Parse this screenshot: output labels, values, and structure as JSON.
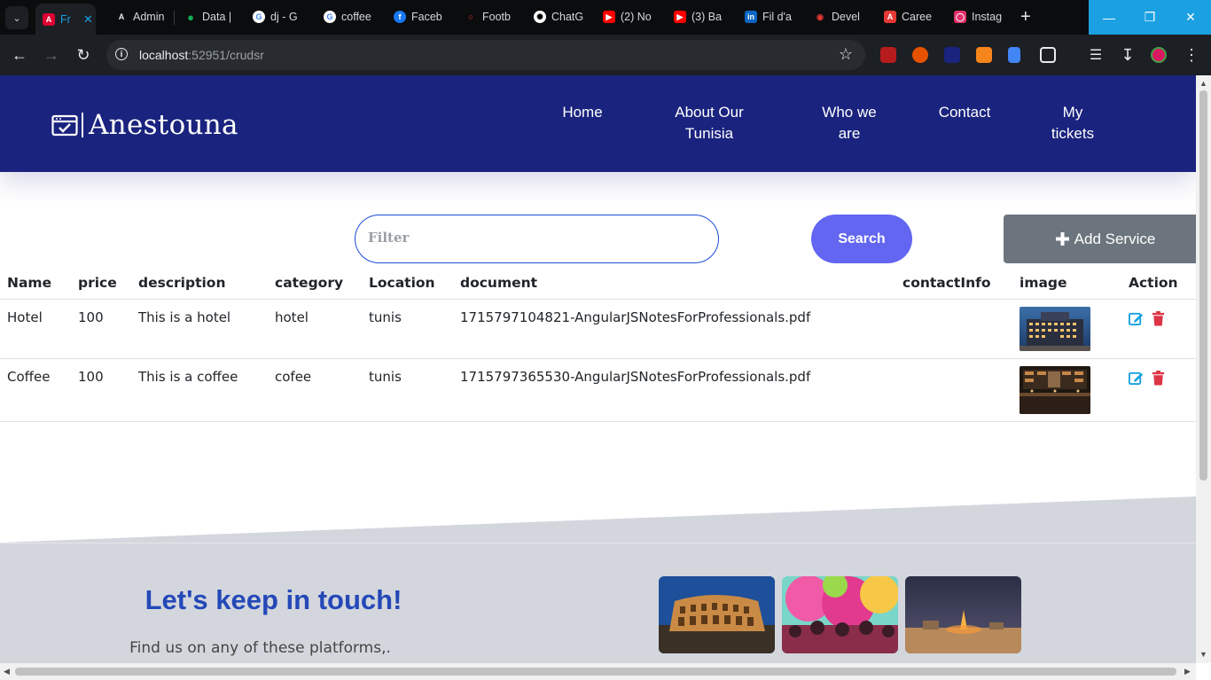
{
  "browser": {
    "tabs": [
      {
        "label": "Fr",
        "icon": "angular-icon",
        "color": "#dd0031",
        "active": true
      },
      {
        "label": "Admin",
        "icon": "angular-a-icon",
        "color": "#9aa0a6"
      },
      {
        "label": "Data |",
        "icon": "mongodb-leaf-icon",
        "color": "#13aa52"
      },
      {
        "label": "dj - G",
        "icon": "google-icon",
        "color": "#ffffff"
      },
      {
        "label": "coffee",
        "icon": "google-icon",
        "color": "#ffffff"
      },
      {
        "label": "Faceb",
        "icon": "facebook-icon",
        "color": "#1877f2"
      },
      {
        "label": "Footb",
        "icon": "football-icon",
        "color": "#ff4b2b"
      },
      {
        "label": "ChatG",
        "icon": "chatgpt-icon",
        "color": "#ffffff"
      },
      {
        "label": "(2) No",
        "icon": "youtube-icon",
        "color": "#ff0000"
      },
      {
        "label": "(3) Ba",
        "icon": "youtube-icon",
        "color": "#ff0000"
      },
      {
        "label": "Fil d'a",
        "icon": "linkedin-icon",
        "color": "#0a66c2"
      },
      {
        "label": "Devel",
        "icon": "ubisoft-icon",
        "color": "#e53935"
      },
      {
        "label": "Caree",
        "icon": "careers-icon",
        "color": "#e53935"
      },
      {
        "label": "Instag",
        "icon": "instagram-icon",
        "color": "#e1306c"
      }
    ],
    "url_host": "localhost",
    "url_rest": ":52951/crudsr"
  },
  "header": {
    "logo_text": "Anestouna",
    "nav": [
      {
        "label_line1": "Home",
        "label_line2": ""
      },
      {
        "label_line1": "About Our",
        "label_line2": "Tunisia"
      },
      {
        "label_line1": "Who we",
        "label_line2": "are"
      },
      {
        "label_line1": "Contact",
        "label_line2": ""
      },
      {
        "label_line1": "My",
        "label_line2": "tickets"
      }
    ]
  },
  "controls": {
    "filter_placeholder": "Filter",
    "search_label": "Search",
    "add_label": "Add Service"
  },
  "table": {
    "columns": [
      "Name",
      "price",
      "description",
      "category",
      "Location",
      "document",
      "contactInfo",
      "image",
      "Action"
    ],
    "rows": [
      {
        "name": "Hotel",
        "price": "100",
        "description": "This is a hotel",
        "category": "hotel",
        "location": "tunis",
        "document": "1715797104821-AngularJSNotesForProfessionals.pdf",
        "contactInfo": "",
        "image": "hotel-photo"
      },
      {
        "name": "Coffee",
        "price": "100",
        "description": "This is a coffee",
        "category": "cofee",
        "location": "tunis",
        "document": "1715797365530-AngularJSNotesForProfessionals.pdf",
        "contactInfo": "",
        "image": "coffee-photo"
      }
    ]
  },
  "footer": {
    "title": "Let's keep in touch!",
    "subtitle": "Find us on any of these platforms,.",
    "gallery": [
      "colosseum-photo",
      "holi-festival-photo",
      "desert-campfire-photo"
    ]
  },
  "colors": {
    "header_bg": "#1a237e",
    "search_bg": "#6366f1",
    "add_bg": "#6c757d",
    "footer_bg": "#d3d6dd",
    "footer_title": "#2448b8",
    "edit_icon": "#17a2e0",
    "delete_icon": "#dc3545"
  }
}
